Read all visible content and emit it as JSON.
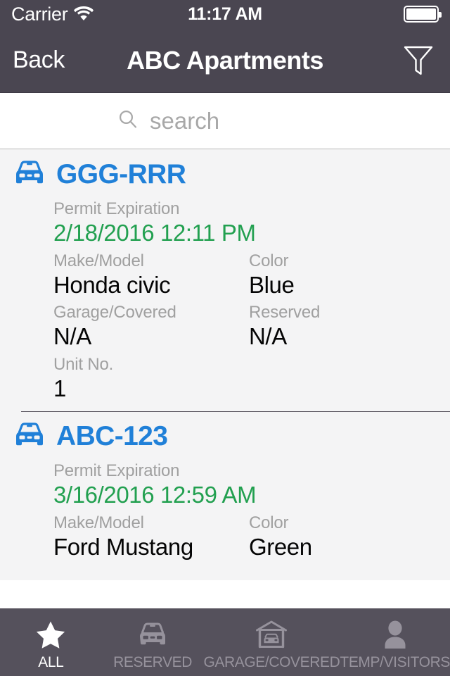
{
  "status_bar": {
    "carrier": "Carrier",
    "wifi_icon": "wifi-icon",
    "time": "11:17 AM",
    "battery_icon": "battery-full-icon"
  },
  "nav_bar": {
    "back_label": "Back",
    "title": "ABC Apartments",
    "filter_icon": "filter-funnel-icon"
  },
  "search": {
    "icon": "search-icon",
    "placeholder": "search",
    "value": ""
  },
  "labels": {
    "permit_expiration": "Permit Expiration",
    "make_model": "Make/Model",
    "color": "Color",
    "garage_covered": "Garage/Covered",
    "reserved": "Reserved",
    "unit_no": "Unit No."
  },
  "colors": {
    "chrome": "#4a4651",
    "tabbar": "#55515c",
    "plate_blue": "#2080d8",
    "expiry_green": "#22a050",
    "label_gray": "#a0a0a0",
    "list_bg": "#f4f4f5"
  },
  "vehicles": [
    {
      "icon": "car-front-icon",
      "plate": "GGG-RRR",
      "permit_expiration": "2/18/2016 12:11 PM",
      "make_model": "Honda civic",
      "color": "Blue",
      "garage_covered": "N/A",
      "reserved": "N/A",
      "unit_no": "1"
    },
    {
      "icon": "car-front-icon",
      "plate": "ABC-123",
      "permit_expiration": "3/16/2016 12:59 AM",
      "make_model": "Ford Mustang",
      "color": "Green"
    }
  ],
  "tab_bar": {
    "items": [
      {
        "icon": "star-icon",
        "label": "ALL",
        "active": true
      },
      {
        "icon": "car-icon",
        "label": "RESERVED",
        "active": false
      },
      {
        "icon": "garage-icon",
        "label": "GARAGE/COVERED",
        "active": false
      },
      {
        "icon": "person-icon",
        "label": "TEMP/VISITORS",
        "active": false
      }
    ]
  }
}
